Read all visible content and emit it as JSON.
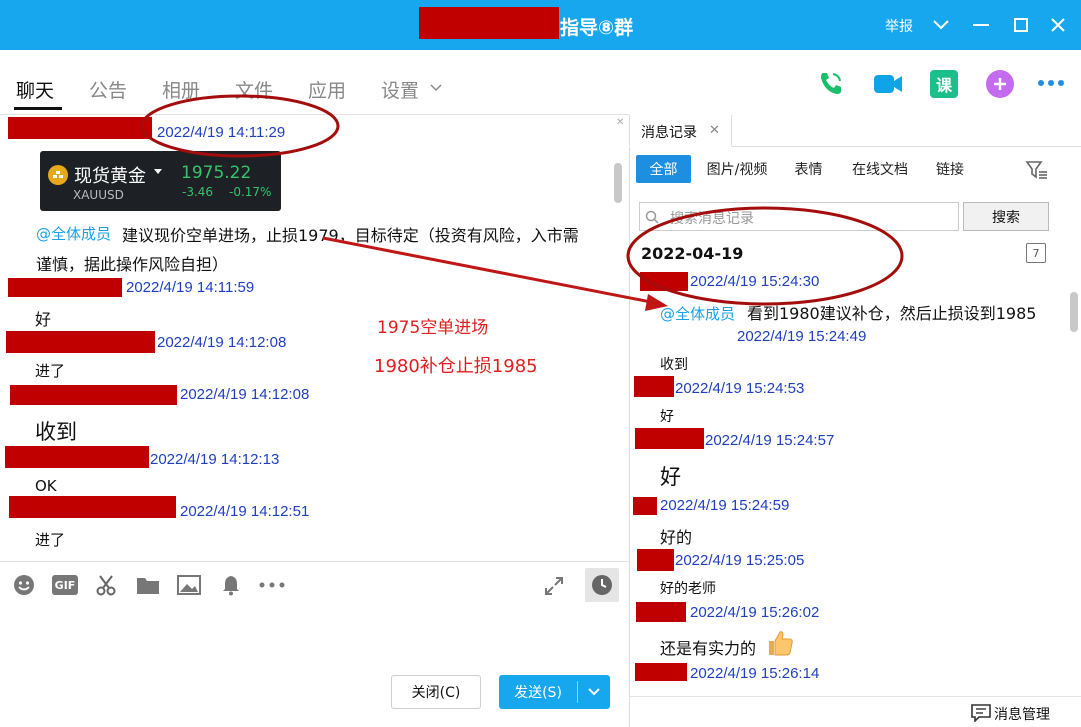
{
  "window": {
    "title": "指导⑧群",
    "report_label": "举报"
  },
  "tabs": [
    {
      "label": "聊天"
    },
    {
      "label": "公告"
    },
    {
      "label": "相册"
    },
    {
      "label": "文件"
    },
    {
      "label": "应用"
    },
    {
      "label": "设置"
    }
  ],
  "chat": {
    "first_time": "2022/4/19 14:11:29",
    "card": {
      "name": "现货黄金",
      "code": "XAUUSD",
      "price": "1975.22",
      "change": "-3.46",
      "change_pct": "-0.17%"
    },
    "mention": "@全体成员",
    "advice_line1": "建议现价空单进场，止损1979，目标待定（投资有风险，入市需",
    "advice_line2": "谨慎，据此操作风险自担）",
    "messages": [
      {
        "time": "2022/4/19 14:11:59",
        "text": "好"
      },
      {
        "time": "2022/4/19 14:12:08",
        "text": "进了"
      },
      {
        "time": "2022/4/19 14:12:08",
        "text": "收到"
      },
      {
        "time": "2022/4/19 14:12:13",
        "text": "OK"
      },
      {
        "time": "2022/4/19 14:12:51",
        "text": "进了"
      }
    ],
    "annotation1": "1975空单进场",
    "annotation2": "1980补仓止损1985"
  },
  "compose": {
    "close_label": "关闭(C)",
    "send_label": "发送(S)"
  },
  "history": {
    "tab_label": "消息记录",
    "filters": [
      "全部",
      "图片/视频",
      "表情",
      "在线文档",
      "链接"
    ],
    "search_placeholder": "搜索消息记录",
    "search_button": "搜索",
    "date": "2022-04-19",
    "calendar_day": "7",
    "first": {
      "time": "2022/4/19 15:24:30",
      "mention": "@全体成员",
      "text": "看到1980建议补仓，然后止损设到1985",
      "time2": "2022/4/19 15:24:49"
    },
    "entries": [
      {
        "text": "收到",
        "time": "2022/4/19 15:24:53"
      },
      {
        "text": "好",
        "time": "2022/4/19 15:24:57"
      },
      {
        "text": "好",
        "time": "2022/4/19 15:24:59"
      },
      {
        "text": "好的",
        "time": "2022/4/19 15:25:05"
      },
      {
        "text": "好的老师",
        "time": "2022/4/19 15:26:02"
      },
      {
        "text": "还是有实力的",
        "time": "2022/4/19 15:26:14"
      }
    ],
    "manage_label": "消息管理"
  }
}
